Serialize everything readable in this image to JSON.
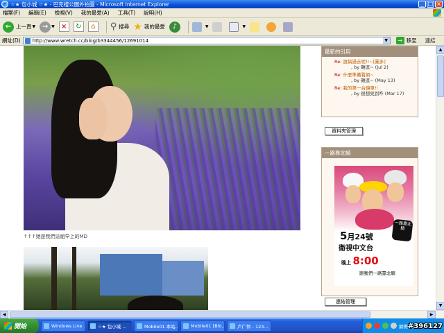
{
  "window": {
    "title": "☆★ 包小城 ☆★ - 巴克禮公園外拍圖 - Microsoft Internet Explorer"
  },
  "menu": {
    "items": [
      "檔案(F)",
      "編輯(E)",
      "檢視(V)",
      "我的最愛(A)",
      "工具(T)",
      "說明(H)"
    ]
  },
  "toolbar": {
    "back_label": "上一頁",
    "search_label": "搜尋",
    "favorites_label": "我的最愛"
  },
  "address": {
    "label": "網址(D)",
    "url": "http://www.wretch.cc/blog/b3344456/12691014",
    "go_label": "移至",
    "links_label": "連結"
  },
  "content": {
    "caption": "↑↑↑她是我們這組早上的MD"
  },
  "sidebar": {
    "recent_title": "最新的引用",
    "recent": [
      {
        "re": "Re:",
        "title": "誰搞過去呢!!~[圖多]",
        "by": ", by 雜逗~ (Jul 2)"
      },
      {
        "re": "Re:",
        "title": "什麼準備看網~",
        "by": ", by 雜逗~ (May 13)"
      },
      {
        "re": "Re:",
        "title": "我的第一台鏡車!!",
        "by": ", by 很想見到咋 (Mar 17)"
      }
    ],
    "folder_button": "資料夾管理",
    "region_title": "一路靠北騎",
    "link_button": "連結管理",
    "poster": {
      "date_num": "5",
      "date_rest": "月24號",
      "channel": "衛視中文台",
      "time_prefix": "晚上",
      "time": "8:00",
      "sub": "跟我們一路靠北騎",
      "seal": "一路靠北騎"
    }
  },
  "taskbar": {
    "start_label": "開始",
    "tasks": [
      "Windows Live ...",
      "☆★ 包小城 ...",
      "Mobile01 本站...",
      "Mobile01 [Blo...",
      "卢广仲 - 123..."
    ],
    "tray_label": "網際網路"
  },
  "watermark": "#396127",
  "colors": {
    "sidebar_head": "#a3907c",
    "re_red": "#c00000",
    "taskbar_blue": "#245edb",
    "poster_time_red": "#e30d16"
  }
}
